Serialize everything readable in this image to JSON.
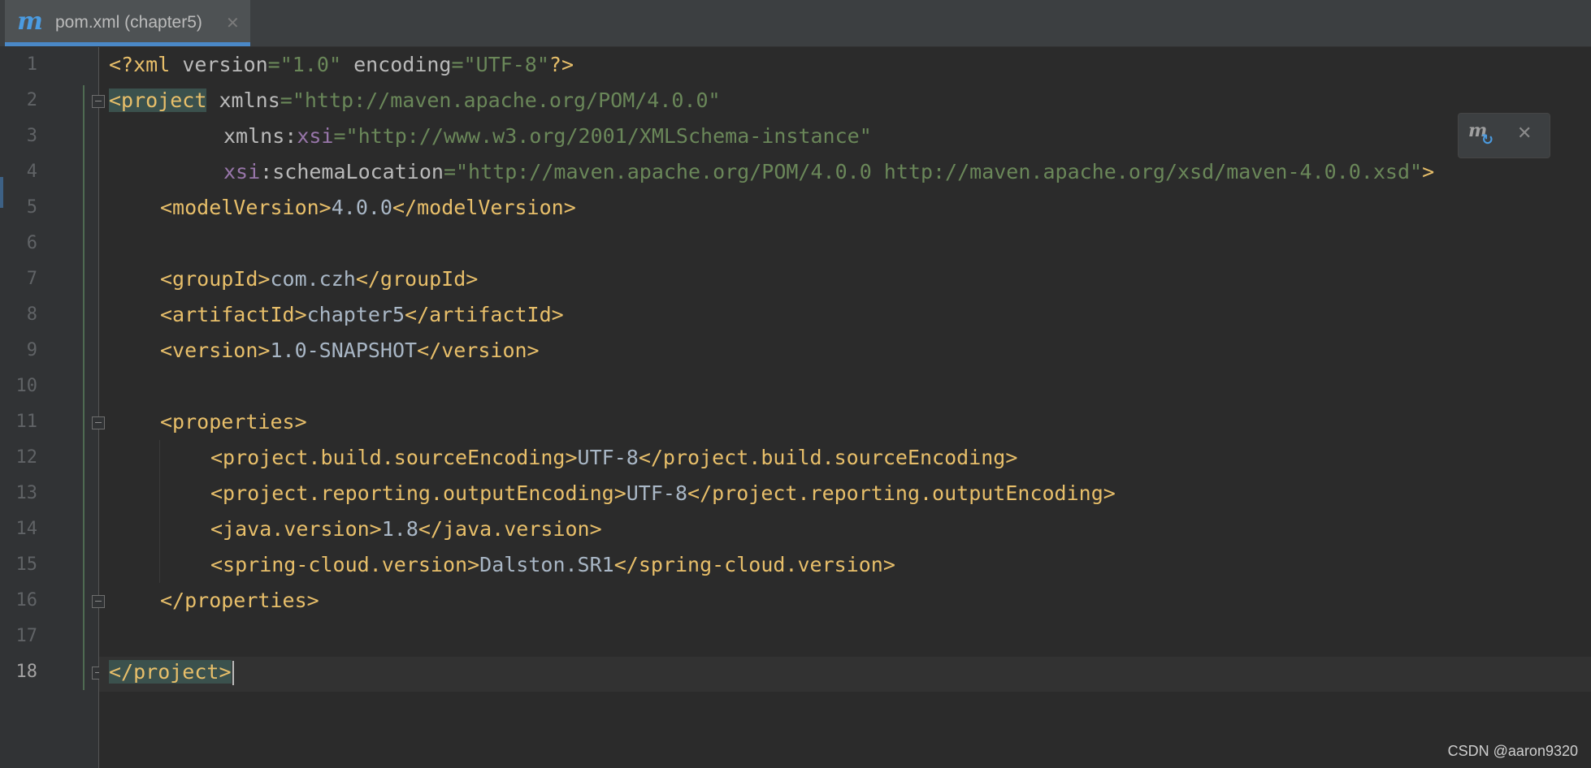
{
  "tab": {
    "logo": "m",
    "title": "pom.xml (chapter5)",
    "close": "✕"
  },
  "editor": {
    "line_numbers": [
      "1",
      "2",
      "3",
      "4",
      "5",
      "6",
      "7",
      "8",
      "9",
      "10",
      "11",
      "12",
      "13",
      "14",
      "15",
      "16",
      "17",
      "18"
    ],
    "current_line": 18,
    "lines": {
      "l1": {
        "decl_open": "<?xml ",
        "version_attr": "version",
        "eq1": "=",
        "version_val": "\"1.0\"",
        "sp": " ",
        "enc_attr": "encoding",
        "eq2": "=",
        "enc_val": "\"UTF-8\"",
        "decl_close": "?>"
      },
      "l2": {
        "open": "<project",
        "sp": " ",
        "attr": "xmlns",
        "eq": "=",
        "val": "\"http://maven.apache.org/POM/4.0.0\""
      },
      "l3": {
        "attr": "xmlns",
        "colon": ":",
        "ns": "xsi",
        "eq": "=",
        "val": "\"http://www.w3.org/2001/XMLSchema-instance\""
      },
      "l4": {
        "ns": "xsi",
        "colon": ":",
        "attr": "schemaLocation",
        "eq": "=",
        "val": "\"http://maven.apache.org/POM/4.0.0 http://maven.apache.org/xsd/maven-4.0.0.xsd\"",
        "close": ">"
      },
      "l5": {
        "open": "<modelVersion>",
        "text": "4.0.0",
        "close": "</modelVersion>"
      },
      "l7": {
        "open": "<groupId>",
        "text": "com.czh",
        "close": "</groupId>"
      },
      "l8": {
        "open": "<artifactId>",
        "text": "chapter5",
        "close": "</artifactId>"
      },
      "l9": {
        "open": "<version>",
        "text": "1.0-SNAPSHOT",
        "close": "</version>"
      },
      "l11": {
        "open": "<properties>"
      },
      "l12": {
        "open": "<project.build.sourceEncoding>",
        "text": "UTF-8",
        "close": "</project.build.sourceEncoding>"
      },
      "l13": {
        "open": "<project.reporting.outputEncoding>",
        "text": "UTF-8",
        "close": "</project.reporting.outputEncoding>"
      },
      "l14": {
        "open": "<java.version>",
        "text": "1.8",
        "close": "</java.version>"
      },
      "l15": {
        "open": "<spring-cloud.version>",
        "text": "Dalston.SR1",
        "close": "</spring-cloud.version>"
      },
      "l16": {
        "close": "</properties>"
      },
      "l18": {
        "close": "</project>"
      }
    }
  },
  "maven_popup": {
    "reload_icon": "m",
    "refresh_glyph": "↻",
    "close": "✕"
  },
  "watermark": "CSDN @aaron9320",
  "colors": {
    "background": "#2b2b2b",
    "tag": "#e8bf6a",
    "string": "#6a8759",
    "namespace": "#9876aa",
    "text": "#a9b7c6",
    "accent": "#4a88c7"
  }
}
